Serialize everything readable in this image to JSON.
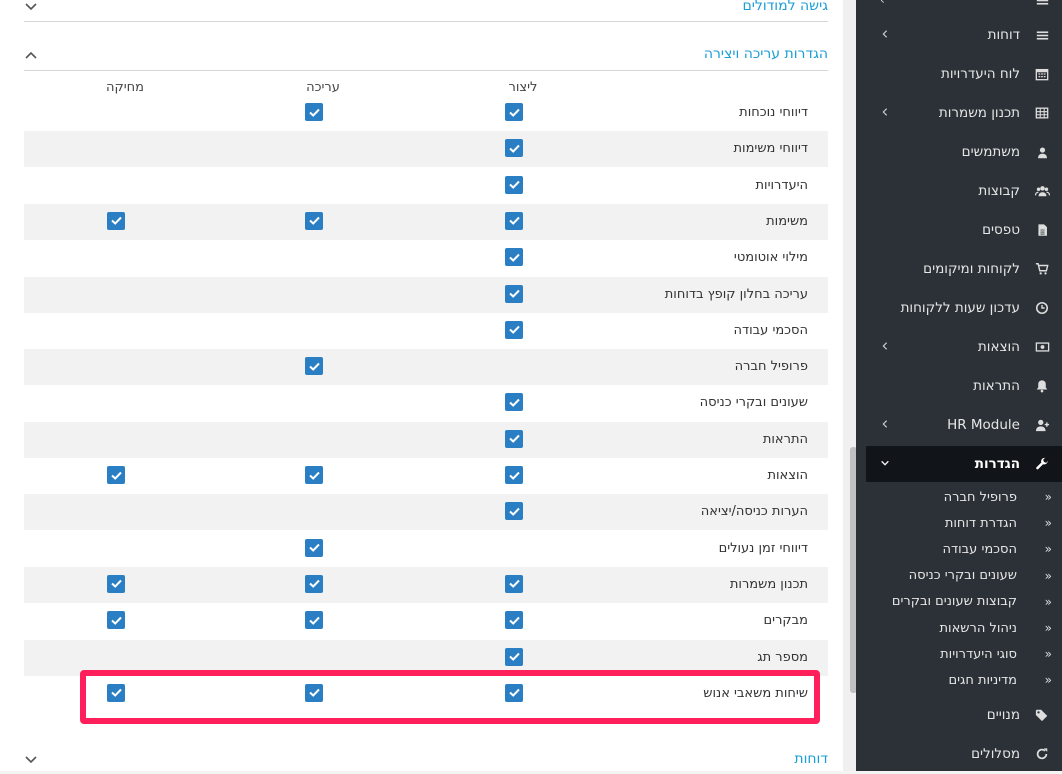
{
  "sections": {
    "top_partial": "גישה למודולים",
    "edit_settings": "הגדרות עריכה ויצירה",
    "reports": "דוחות"
  },
  "columns": {
    "create": "ליצור",
    "edit": "עריכה",
    "delete": "מחיקה"
  },
  "permissions": [
    {
      "label": "דיווחי נוכחות",
      "create": true,
      "edit": true,
      "delete": false
    },
    {
      "label": "דיווחי משימות",
      "create": true,
      "edit": false,
      "delete": false
    },
    {
      "label": "היעדרויות",
      "create": true,
      "edit": false,
      "delete": false
    },
    {
      "label": "משימות",
      "create": true,
      "edit": true,
      "delete": true
    },
    {
      "label": "מילוי אוטומטי",
      "create": true,
      "edit": false,
      "delete": false
    },
    {
      "label": "עריכה בחלון קופץ בדוחות",
      "create": true,
      "edit": false,
      "delete": false
    },
    {
      "label": "הסכמי עבודה",
      "create": true,
      "edit": false,
      "delete": false
    },
    {
      "label": "פרופיל חברה",
      "create": false,
      "edit": true,
      "delete": false
    },
    {
      "label": "שעונים ובקרי כניסה",
      "create": true,
      "edit": false,
      "delete": false
    },
    {
      "label": "התראות",
      "create": true,
      "edit": false,
      "delete": false
    },
    {
      "label": "הוצאות",
      "create": true,
      "edit": true,
      "delete": true
    },
    {
      "label": "הערות כניסה/יציאה",
      "create": true,
      "edit": false,
      "delete": false
    },
    {
      "label": "דיווחי זמן נעולים",
      "create": false,
      "edit": true,
      "delete": false
    },
    {
      "label": "תכנון משמרות",
      "create": true,
      "edit": true,
      "delete": true
    },
    {
      "label": "מבקרים",
      "create": true,
      "edit": true,
      "delete": true
    },
    {
      "label": "מספר תג",
      "create": true,
      "edit": false,
      "delete": false
    },
    {
      "label": "שיחות משאבי אנוש",
      "create": true,
      "edit": true,
      "delete": true
    }
  ],
  "sidebar": {
    "items": [
      {
        "label": "דוחות",
        "icon": "list-icon",
        "caret": true
      },
      {
        "label": "לוח היעדרויות",
        "icon": "calendar-icon",
        "caret": false
      },
      {
        "label": "תכנון משמרות",
        "icon": "table-icon",
        "caret": true
      },
      {
        "label": "משתמשים",
        "icon": "user-icon",
        "caret": false
      },
      {
        "label": "קבוצות",
        "icon": "users-icon",
        "caret": false
      },
      {
        "label": "טפסים",
        "icon": "file-icon",
        "caret": false
      },
      {
        "label": "לקוחות ומיקומים",
        "icon": "cart-icon",
        "caret": false
      },
      {
        "label": "עדכון שעות ללקוחות",
        "icon": "clock-icon",
        "caret": false
      },
      {
        "label": "הוצאות",
        "icon": "money-icon",
        "caret": true
      },
      {
        "label": "התראות",
        "icon": "bell-icon",
        "caret": false
      },
      {
        "label": "HR Module",
        "icon": "user-plus-icon",
        "caret": true
      },
      {
        "label": "הגדרות",
        "icon": "wrench-icon",
        "caret": true,
        "active": true
      }
    ],
    "sub_items": [
      "פרופיל חברה",
      "הגדרת דוחות",
      "הסכמי עבודה",
      "שעונים ובקרי כניסה",
      "קבוצות שעונים ובקרים",
      "ניהול הרשאות",
      "סוגי היעדרויות",
      "מדיניות חגים"
    ],
    "bottom_items": [
      {
        "label": "מנויים",
        "icon": "tags-icon"
      },
      {
        "label": "מסלולים",
        "icon": "refresh-icon"
      }
    ]
  },
  "colors": {
    "accent": "#1a9ed6",
    "checkbox": "#2a7ec4",
    "sidebar_bg": "#2b3137",
    "highlight": "#ff1f5a"
  }
}
